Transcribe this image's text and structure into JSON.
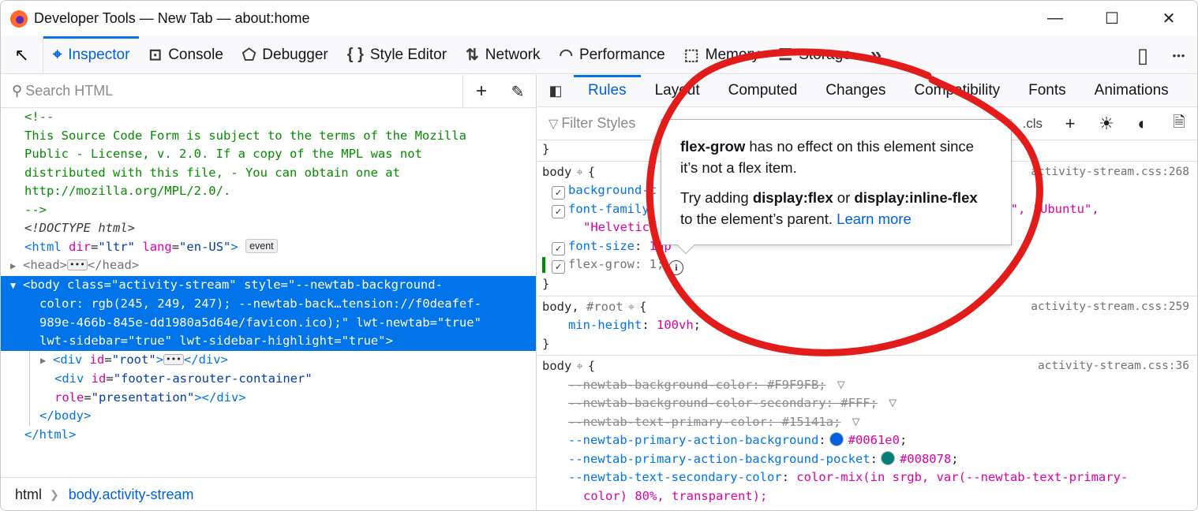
{
  "window": {
    "title": "Developer Tools — New Tab — about:home",
    "controls": {
      "minimize": "—",
      "maximize": "☐",
      "close": "✕"
    }
  },
  "toolbar": {
    "picker_icon": "↖",
    "tools": [
      {
        "label": "Inspector",
        "icon": "⌖",
        "active": true
      },
      {
        "label": "Console",
        "icon": "⊡"
      },
      {
        "label": "Debugger",
        "icon": "⬠"
      },
      {
        "label": "Style Editor",
        "icon": "{ }"
      },
      {
        "label": "Network",
        "icon": "⇅"
      },
      {
        "label": "Performance",
        "icon": "◠"
      },
      {
        "label": "Memory",
        "icon": "⬚"
      },
      {
        "label": "Storage",
        "icon": "☰"
      }
    ],
    "overflow_icon": "»",
    "responsive_icon": "▯",
    "more_icon": "•••"
  },
  "inspector": {
    "search": {
      "placeholder": "Search HTML",
      "value": ""
    },
    "add_node_icon": "+",
    "eyedropper_icon": "✎",
    "markup": {
      "comment_open": "<!--",
      "comment_lines": [
        "This Source Code Form is subject to the terms of the Mozilla",
        "Public - License, v. 2.0. If a copy of the MPL was not",
        "distributed with this file, - You can obtain one at",
        "http://mozilla.org/MPL/2.0/."
      ],
      "comment_close": "-->",
      "doctype": "<!DOCTYPE html>",
      "html_open": {
        "tag": "<html",
        "attrs": [
          {
            "name": "dir",
            "value": "\"ltr\""
          },
          {
            "name": "lang",
            "value": "\"en-US\""
          }
        ],
        "close": ">",
        "badge": "event"
      },
      "head": {
        "open": "<head>",
        "dots": "•••",
        "close": "</head>"
      },
      "body_selected_lines": [
        "<body class=\"activity-stream\" style=\"--newtab-background-",
        "color: rgb(245, 249, 247); --newtab-back…tension://f0deafef-",
        "989e-466b-845e-dd1980a5d64e/favicon.ico);\" lwt-newtab=\"true\"",
        "lwt-sidebar=\"true\" lwt-sidebar-highlight=\"true\">"
      ],
      "root_div": {
        "open": "<div",
        "attr": "id",
        "value": "\"root\"",
        "gt": ">",
        "dots": "•••",
        "close": "</div>"
      },
      "footer_div": {
        "open": "<div",
        "attr": "id",
        "value": "\"footer-asrouter-container\"",
        "attr2": "role",
        "value2": "\"presentation\"",
        "close": "></div>"
      },
      "body_close": "</body>",
      "html_close": "</html>"
    },
    "breadcrumb": [
      "html",
      "body.activity-stream"
    ]
  },
  "sidebar": {
    "tabs": [
      {
        "label": "Rules",
        "active": true
      },
      {
        "label": "Layout"
      },
      {
        "label": "Computed"
      },
      {
        "label": "Changes"
      },
      {
        "label": "Compatibility"
      },
      {
        "label": "Fonts"
      },
      {
        "label": "Animations"
      }
    ],
    "filter": {
      "placeholder": "Filter Styles",
      "value": ""
    },
    "filter_right_text": ".cls",
    "buttons": {
      "add_rule": "+",
      "light_mode": "☀",
      "dark_mode": "◐",
      "print": "🗎"
    }
  },
  "rules": [
    {
      "selector": "body",
      "source": "activity-stream.css:268",
      "declarations": [
        {
          "prop": "background-c",
          "value": "",
          "checked": true
        },
        {
          "prop": "font-family",
          "value": "",
          "checked": true,
          "continued": "\"Helvetica",
          "visible_tail": "UI\", \"Ubuntu\","
        },
        {
          "prop": "font-size",
          "value": "16p",
          "checked": true
        },
        {
          "prop": "flex-grow",
          "value": "1",
          "checked": true,
          "inactive": true,
          "changed": true,
          "info_icon": "i"
        }
      ]
    },
    {
      "selector": "body,",
      "selector_extra": "#root",
      "source": "activity-stream.css:259",
      "declarations": [
        {
          "prop": "min-height",
          "value": "100vh"
        }
      ]
    },
    {
      "selector": "body",
      "source": "activity-stream.css:36",
      "declarations": [
        {
          "prop": "--newtab-background-color",
          "value": "#F9F9FB",
          "overridden": true
        },
        {
          "prop": "--newtab-background-color-secondary",
          "value": "#FFF",
          "overridden": true
        },
        {
          "prop": "--newtab-text-primary-color",
          "value": "#15141a",
          "overridden": true
        },
        {
          "prop": "--newtab-primary-action-background",
          "value": "#0061e0",
          "swatch": "#0061e0"
        },
        {
          "prop": "--newtab-primary-action-background-pocket",
          "value": "#008078",
          "swatch": "#008078"
        },
        {
          "prop": "--newtab-text-secondary-color",
          "value": "color-mix(in srgb, var(--newtab-text-primary-",
          "value_cont": "color) 80%, transparent);"
        }
      ]
    }
  ],
  "tooltip": {
    "line1_bold": "flex-grow",
    "line1_rest": " has no effect on this element since it’s not a flex item.",
    "line2_a": "Try adding ",
    "line2_b1": "display:flex",
    "line2_mid": " or ",
    "line2_b2": "display:inline-flex",
    "line2_c": " to the element’s parent. ",
    "link": "Learn more"
  },
  "colors": {
    "accent": "#0074e8",
    "selected_row": "#0074e8",
    "annotation": "#e21b1b",
    "changed_marker": "#058b00"
  }
}
